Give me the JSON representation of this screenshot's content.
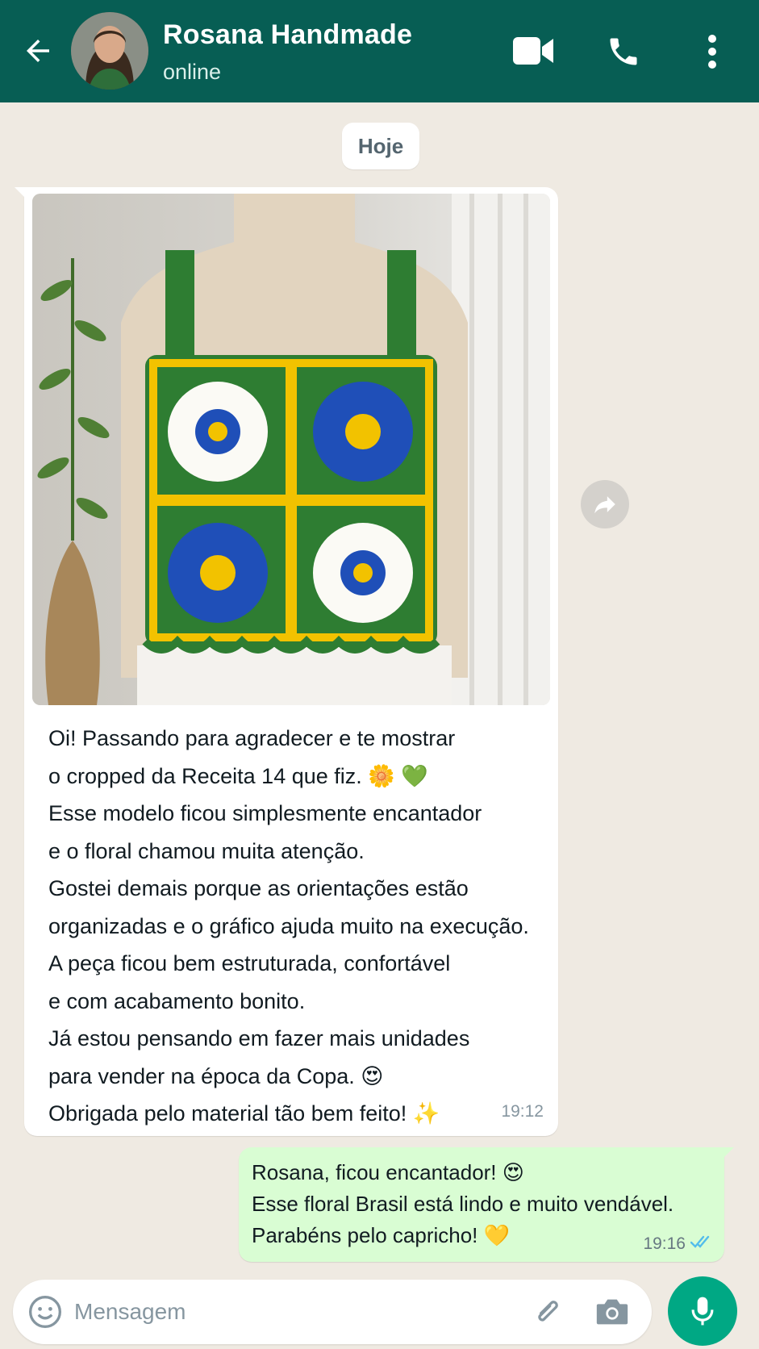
{
  "header": {
    "contact_name": "Rosana Handmade",
    "status": "online",
    "bg_color": "#075e54"
  },
  "chat": {
    "date_label": "Hoje",
    "incoming": {
      "image_alt": "crocheted cropped top with granny-square flowers in green, yellow, blue and white on a dress form",
      "lines": [
        "Oi! Passando para agradecer e te mostrar",
        "o cropped da Receita 14 que fiz. 🌼 💚",
        "Esse modelo ficou simplesmente encantador",
        "e o floral chamou muita atenção.",
        "Gostei demais porque as orientações estão",
        "organizadas e o gráfico ajuda muito na execução.",
        "A peça ficou bem estruturada, confortável",
        "e com acabamento bonito.",
        "Já estou pensando em fazer mais unidades",
        "para vender na época da Copa. 😍",
        "Obrigada pelo material tão bem feito! ✨"
      ],
      "time": "19:12"
    },
    "outgoing": {
      "lines": [
        "Rosana, ficou encantador! 😍",
        "Esse floral Brasil está lindo e muito vendável.",
        "Parabéns pelo capricho! 💛"
      ],
      "time": "19:16",
      "status_icon": "double-check-read-icon",
      "check_color": "#53bdeb"
    }
  },
  "composer": {
    "placeholder": "Mensagem",
    "mic_color": "#00a884"
  }
}
